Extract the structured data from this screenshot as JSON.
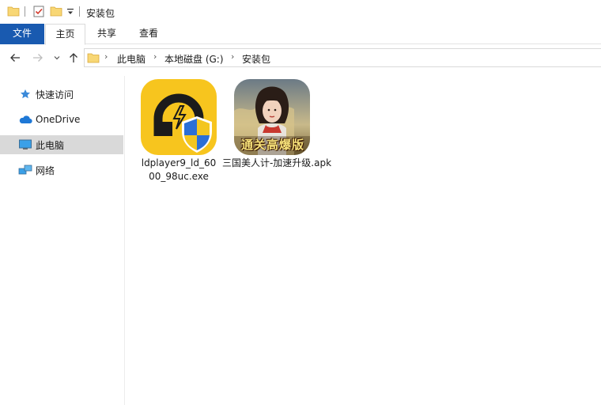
{
  "window": {
    "title": "安装包"
  },
  "ribbon": {
    "tabs": [
      {
        "label": "文件"
      },
      {
        "label": "主页"
      },
      {
        "label": "共享"
      },
      {
        "label": "查看"
      }
    ]
  },
  "address": {
    "crumbs": [
      "此电脑",
      "本地磁盘 (G:)",
      "安装包"
    ]
  },
  "sidebar": {
    "items": [
      {
        "label": "快速访问",
        "icon": "star-icon"
      },
      {
        "label": "OneDrive",
        "icon": "cloud-icon"
      },
      {
        "label": "此电脑",
        "icon": "computer-icon",
        "selected": true
      },
      {
        "label": "网络",
        "icon": "network-icon"
      }
    ]
  },
  "files": [
    {
      "name_line1": "ldplayer9_ld_60",
      "name_line2": "00_98uc.exe",
      "icon": "ldplayer-installer-icon"
    },
    {
      "name_line1": "三国美人计-加速升级.apk",
      "icon": "game-apk-icon",
      "badge_text": "通关高爆版"
    }
  ],
  "colors": {
    "file_tab": "#195ab0",
    "selected_sidebar": "#d9d9d9",
    "ldplayer_yellow": "#f7c51e",
    "folder_yellow": "#f8d775"
  }
}
